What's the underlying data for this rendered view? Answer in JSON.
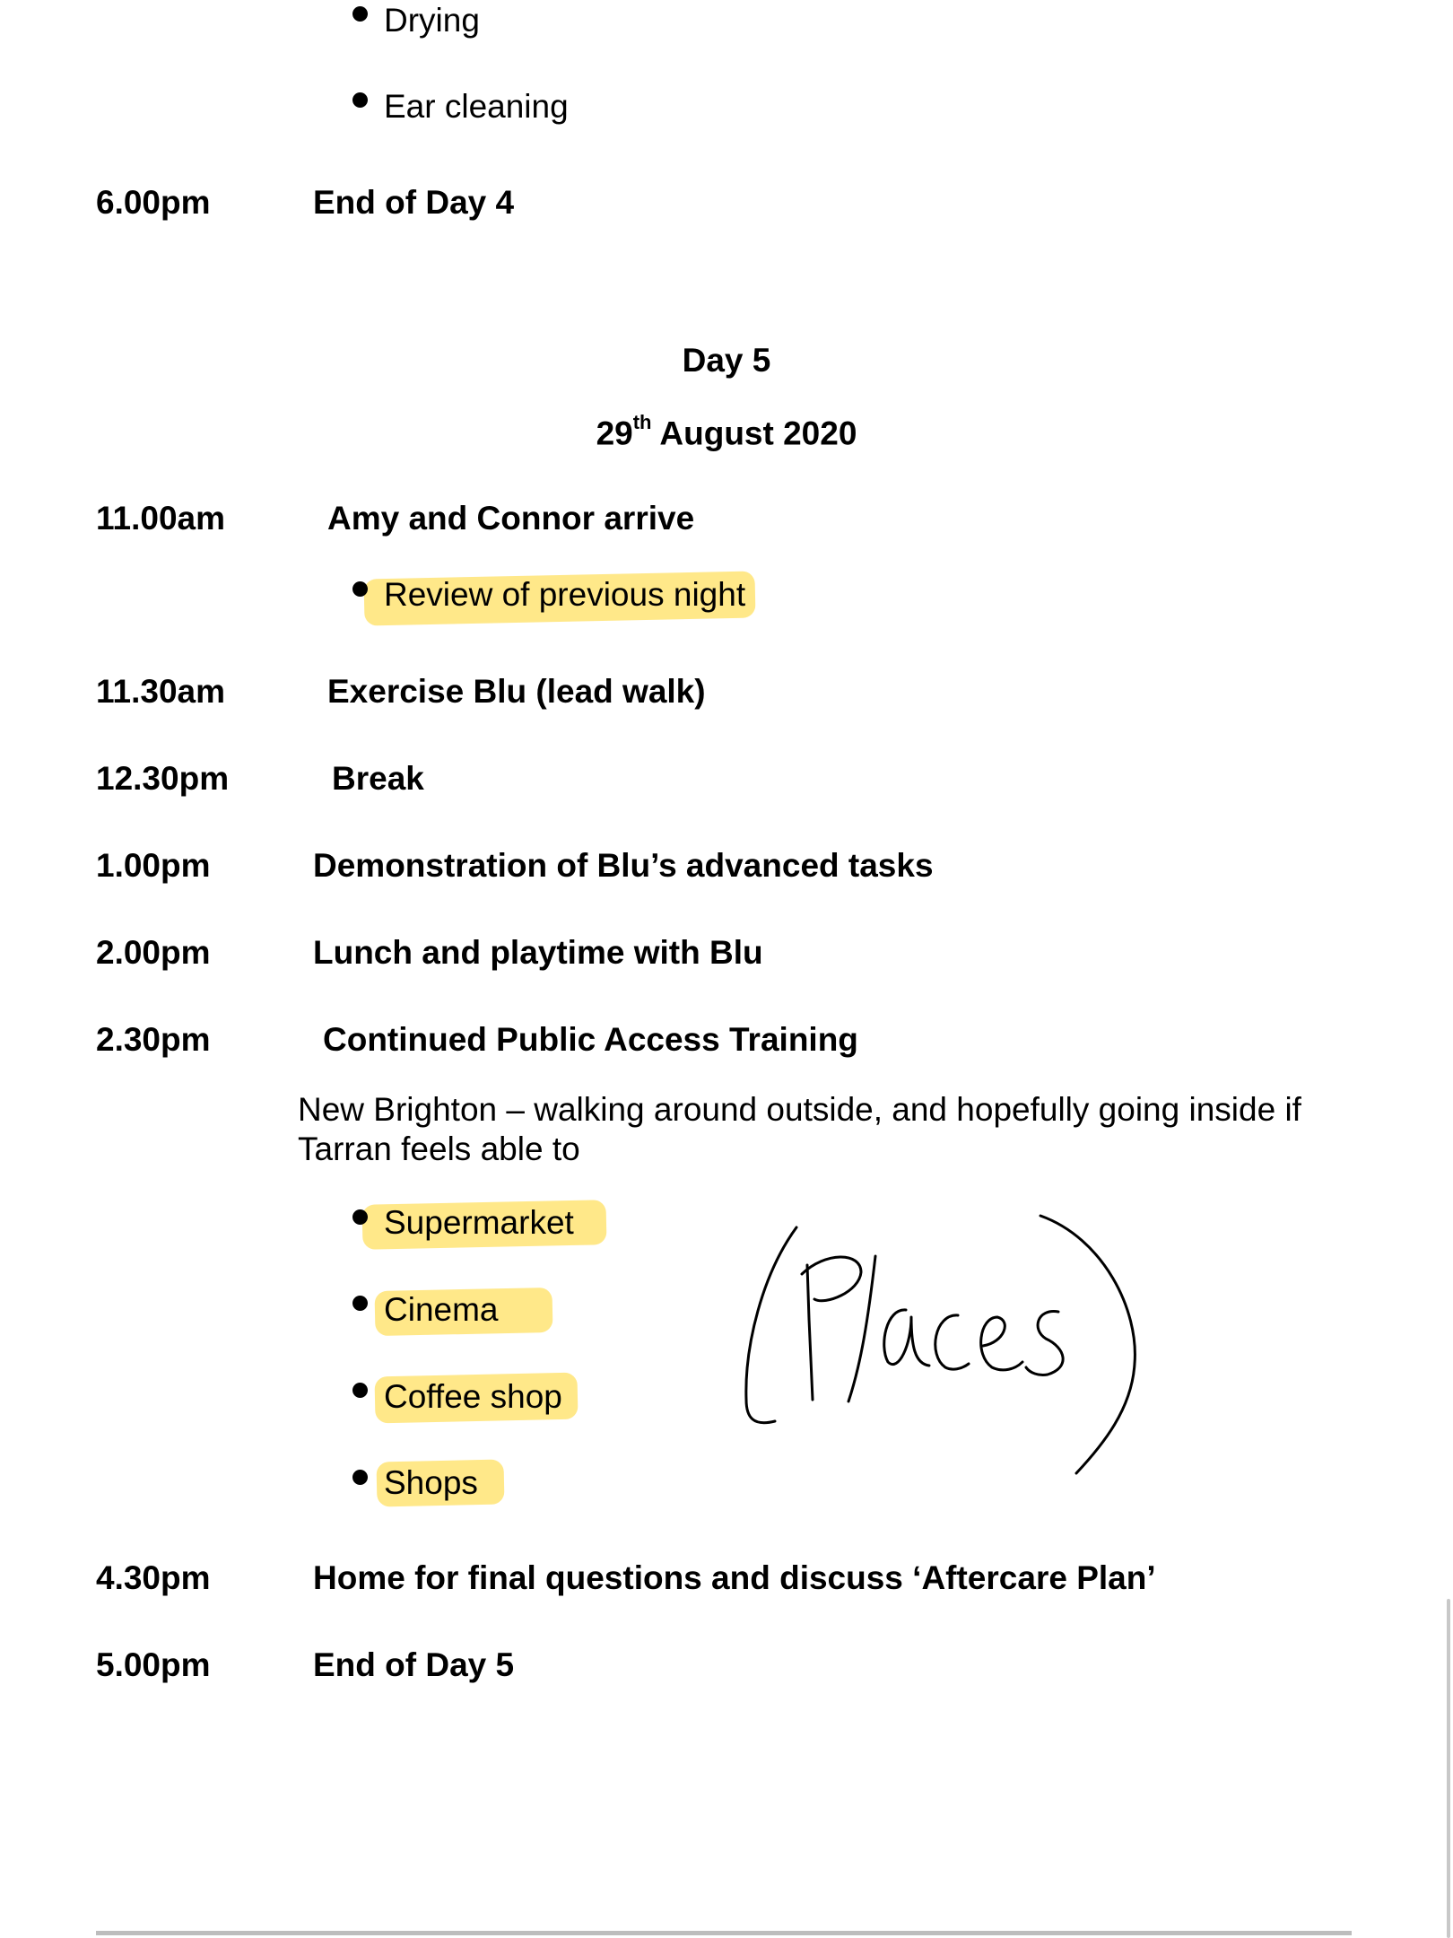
{
  "top_bullets": [
    "Drying",
    "Ear cleaning"
  ],
  "day4_end": {
    "time": "6.00pm",
    "title": "End of Day 4"
  },
  "day5_header": {
    "day": "Day 5",
    "date_num": "29",
    "date_sup": "th",
    "date_rest": " August 2020"
  },
  "schedule": [
    {
      "time": "11.00am",
      "title": "Amy and Connor arrive",
      "bullets": [
        "Review of previous night"
      ]
    },
    {
      "time": "11.30am",
      "title": "Exercise Blu (lead walk)"
    },
    {
      "time": "12.30pm",
      "title": "Break"
    },
    {
      "time": "1.00pm",
      "title": "Demonstration of Blu’s advanced tasks"
    },
    {
      "time": "2.00pm",
      "title": "Lunch and playtime with Blu"
    },
    {
      "time": "2.30pm",
      "title": "Continued Public Access Training",
      "note": "New Brighton – walking around outside, and hopefully going inside if Tarran feels able to",
      "bullets": [
        "Supermarket",
        "Cinema",
        "Coffee shop",
        "Shops"
      ]
    },
    {
      "time": "4.30pm",
      "title": "Home for final questions and discuss ‘Aftercare Plan’"
    },
    {
      "time": "5.00pm",
      "title": "End of Day 5"
    }
  ],
  "handwritten_annotation": "(Places)",
  "highlight_color": "#FFD628"
}
